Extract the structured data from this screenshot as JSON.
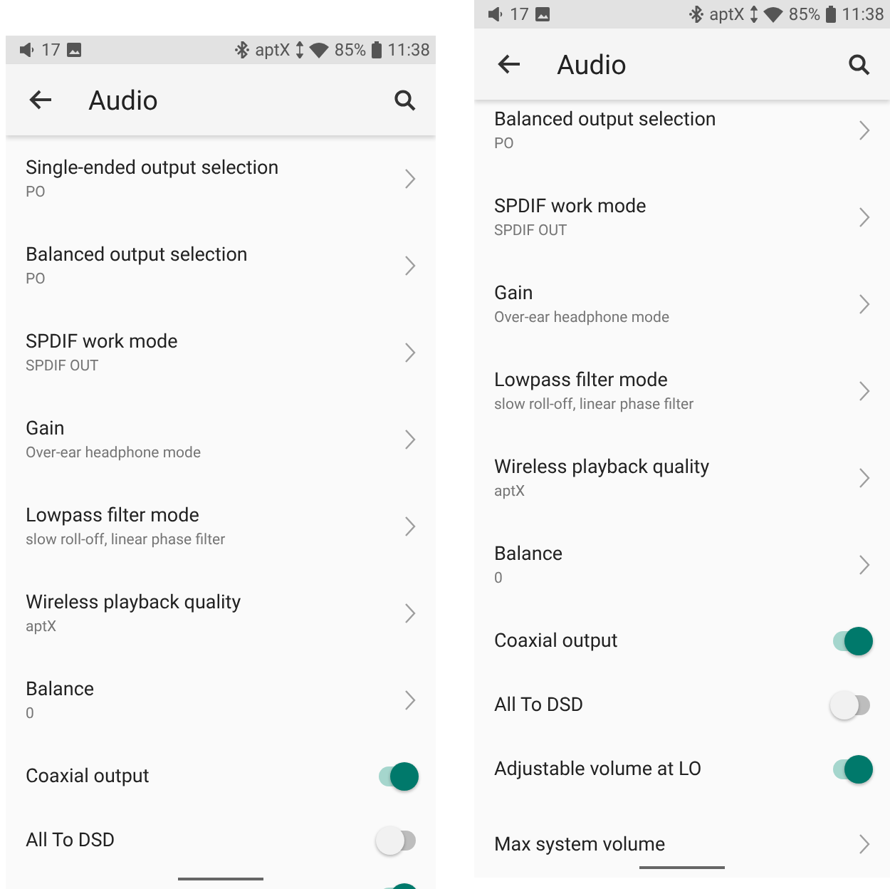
{
  "screens": [
    {
      "status_bar": {
        "volume": "17",
        "codec": "aptX",
        "battery": "85%",
        "time": "11:38"
      },
      "app_bar": {
        "title": "Audio"
      },
      "scrolled": false,
      "items": [
        {
          "kind": "nav",
          "title": "Single-ended output selection",
          "value": "PO"
        },
        {
          "kind": "nav",
          "title": "Balanced output selection",
          "value": "PO"
        },
        {
          "kind": "nav",
          "title": "SPDIF work mode",
          "value": "SPDIF OUT"
        },
        {
          "kind": "nav",
          "title": "Gain",
          "value": "Over-ear headphone mode"
        },
        {
          "kind": "nav",
          "title": "Lowpass filter mode",
          "value": "slow roll-off, linear phase filter"
        },
        {
          "kind": "nav",
          "title": "Wireless playback quality",
          "value": "aptX"
        },
        {
          "kind": "nav",
          "title": "Balance",
          "value": "0"
        },
        {
          "kind": "toggle",
          "title": "Coaxial output",
          "on": true
        },
        {
          "kind": "toggle",
          "title": "All To DSD",
          "on": false
        },
        {
          "kind": "toggle",
          "on": true
        }
      ]
    },
    {
      "status_bar": {
        "volume": "17",
        "codec": "aptX",
        "battery": "85%",
        "time": "11:38"
      },
      "app_bar": {
        "title": "Audio"
      },
      "scrolled": true,
      "items": [
        {
          "kind": "nav",
          "title": "Balanced output selection",
          "value": "PO"
        },
        {
          "kind": "nav",
          "title": "SPDIF work mode",
          "value": "SPDIF OUT"
        },
        {
          "kind": "nav",
          "title": "Gain",
          "value": "Over-ear headphone mode"
        },
        {
          "kind": "nav",
          "title": "Lowpass filter mode",
          "value": "slow roll-off, linear phase filter"
        },
        {
          "kind": "nav",
          "title": "Wireless playback quality",
          "value": "aptX"
        },
        {
          "kind": "nav",
          "title": "Balance",
          "value": "0"
        },
        {
          "kind": "toggle",
          "title": "Coaxial output",
          "on": true
        },
        {
          "kind": "toggle",
          "title": "All To DSD",
          "on": false
        },
        {
          "kind": "toggle",
          "title": "Adjustable volume at LO",
          "on": true
        },
        {
          "kind": "nav",
          "title": "Max system volume"
        }
      ]
    }
  ]
}
